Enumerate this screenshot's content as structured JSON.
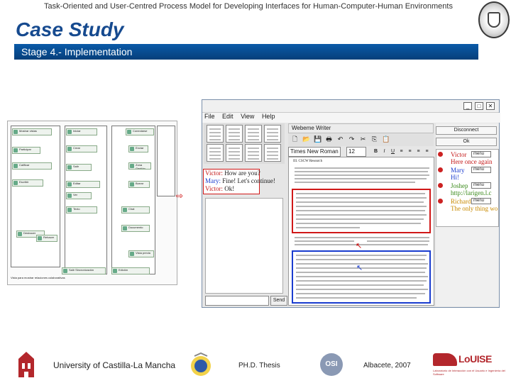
{
  "header": {
    "title": "Task-Oriented and User-Centred Process Model for Developing Interfaces for Human-Computer-Human Environments",
    "case": "Case Study",
    "stage": "Stage 4.- Implementation"
  },
  "app": {
    "menu": [
      "File",
      "Edit",
      "View",
      "Help"
    ],
    "editor_title": "Webeme Writer",
    "font": "Times New Roman",
    "size": "12",
    "doc_heading": "III. CSCW Research",
    "buttons": {
      "disconnect": "Disconnect",
      "ok": "Ok",
      "send": "Send"
    },
    "users": [
      {
        "name": "Victor",
        "msg": "Here once again",
        "menu": "menu"
      },
      {
        "name": "Mary",
        "msg": "Hi!",
        "menu": "menu"
      },
      {
        "name": "Joshep",
        "msg": "http://larigen.l.c",
        "menu": "menu"
      },
      {
        "name": "Richard",
        "msg": "The only thing wo",
        "menu": "menu"
      }
    ],
    "chat": [
      {
        "who": "Victor:",
        "text": "How are you?"
      },
      {
        "who": "Mary:",
        "text": "Fine! Let's continue!"
      },
      {
        "who": "Victor:",
        "text": "Ok!"
      }
    ]
  },
  "diagram": {
    "nodes": [
      "Mostrar vistas",
      "Iniciar",
      "Conectarse",
      "Participar",
      "Crear",
      "Enviar",
      "Calificar",
      "Salir",
      "Zona Gestión",
      "Escribir",
      "Editar",
      "Borrar",
      "Ver",
      "Texto",
      "Chat",
      "Deshacer",
      "Rehacer",
      "Documento",
      "Salir Sincronización",
      "Edición",
      "Vista previa"
    ],
    "footer": "Vista para mostrar relaciones colaborativas"
  },
  "footer": {
    "university": "University of Castilla-La Mancha",
    "phd": "PH.D. Thesis",
    "osi": "OSI",
    "date": "Albacete, 2007",
    "louise": "LoUISE",
    "louise_sub": "Laboratorio de Interacción con el Usuario e Ingeniería del Software"
  },
  "colors": {
    "accent": "#164a8f",
    "stage_bar": "#0a5aa8",
    "highlight_red": "#d01818",
    "highlight_blue": "#1a3ccf",
    "louise": "#b3272c"
  }
}
